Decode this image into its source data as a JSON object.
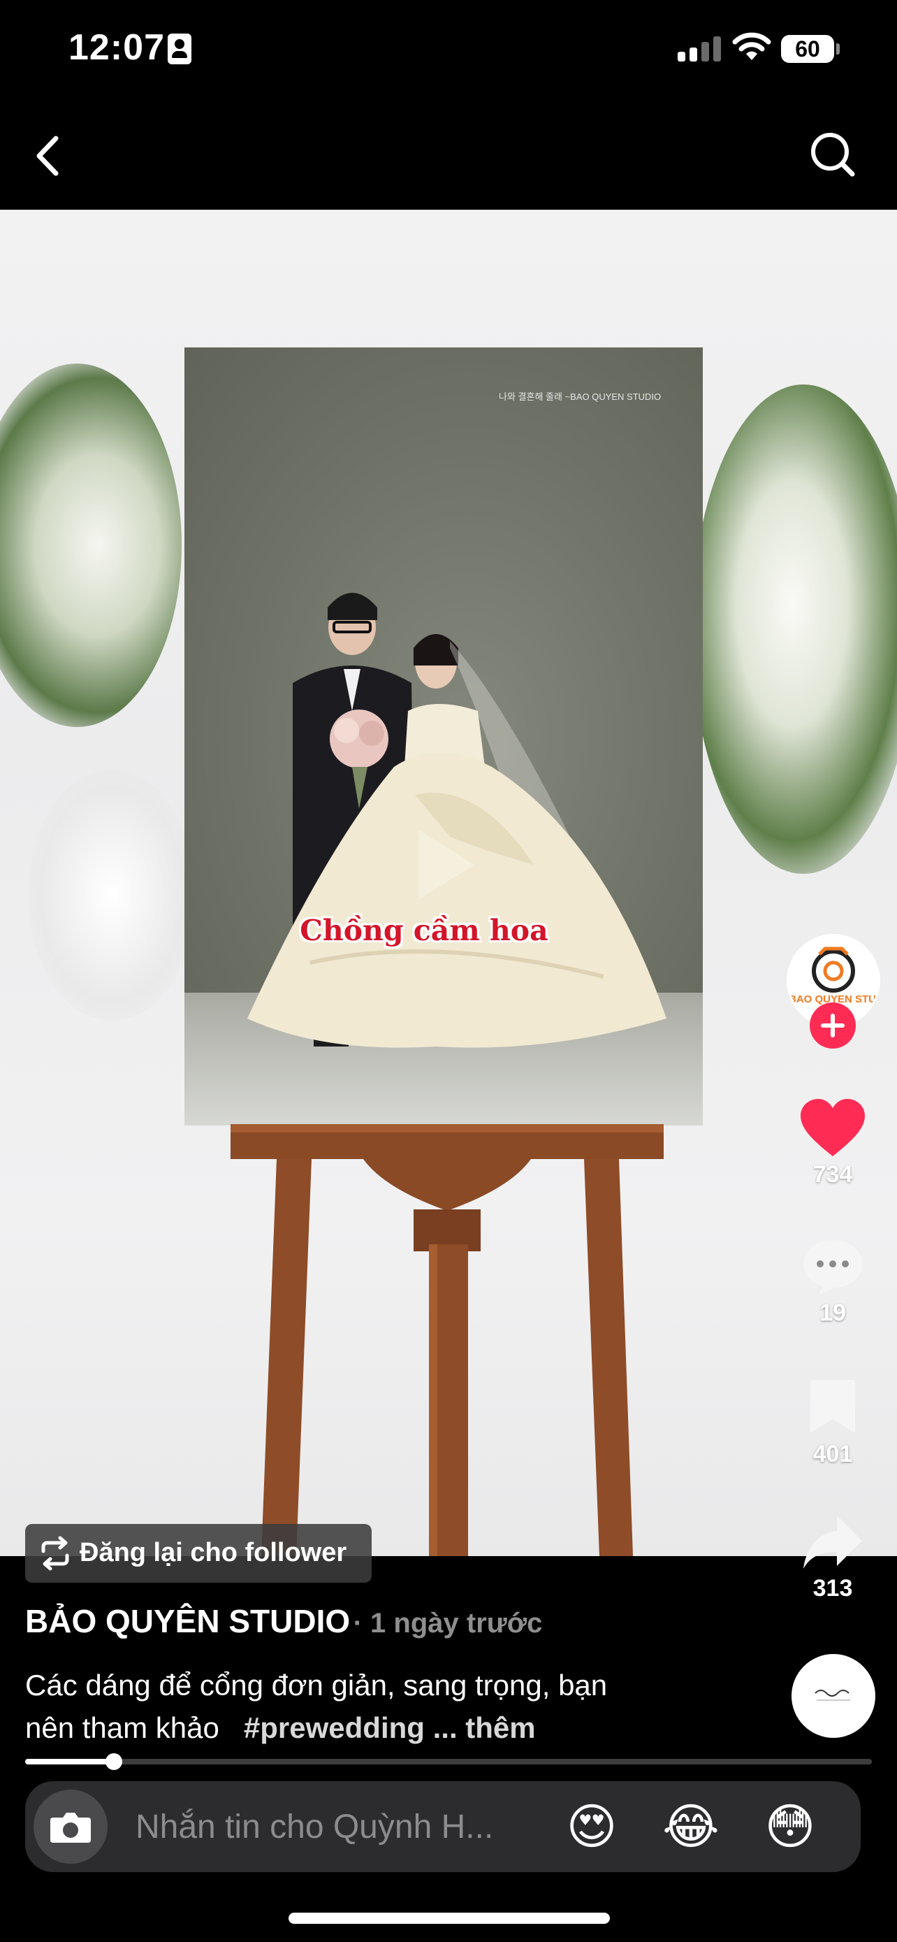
{
  "status_bar": {
    "time": "12:07",
    "battery": "60",
    "icons": [
      "contact-card-icon",
      "cellular-signal-icon",
      "wifi-icon",
      "battery-icon"
    ]
  },
  "top_nav": {
    "icons": [
      "chevron-left-icon",
      "search-icon"
    ]
  },
  "video": {
    "watermark": "나와 결혼해 줄래 ~BAO QUYEN STUDIO",
    "caption_overlay": "Chồng cầm hoa"
  },
  "creator": {
    "avatar_icon": "studio-logo-avatar",
    "avatar_text": "BAO QUYEN STUDIO"
  },
  "actions": {
    "likes": "734",
    "comments": "19",
    "saves": "401",
    "shares": "313",
    "like_color": "#fe2c55"
  },
  "repost": {
    "label": "Đăng lại cho follower"
  },
  "post": {
    "author": "BẢO QUYÊN STUDIO",
    "time": "· 1 ngày trước",
    "description_line1": "Các dáng để cổng đơn giản, sang trọng, bạn",
    "description_line2": "nên tham khảo",
    "hashtag": "#prewedding",
    "more": "... thêm"
  },
  "progress": {
    "fraction": 0.105
  },
  "message_bar": {
    "placeholder": "Nhắn tin cho Quỳnh H...",
    "emojis": [
      "😍",
      "😂",
      "😳"
    ]
  }
}
